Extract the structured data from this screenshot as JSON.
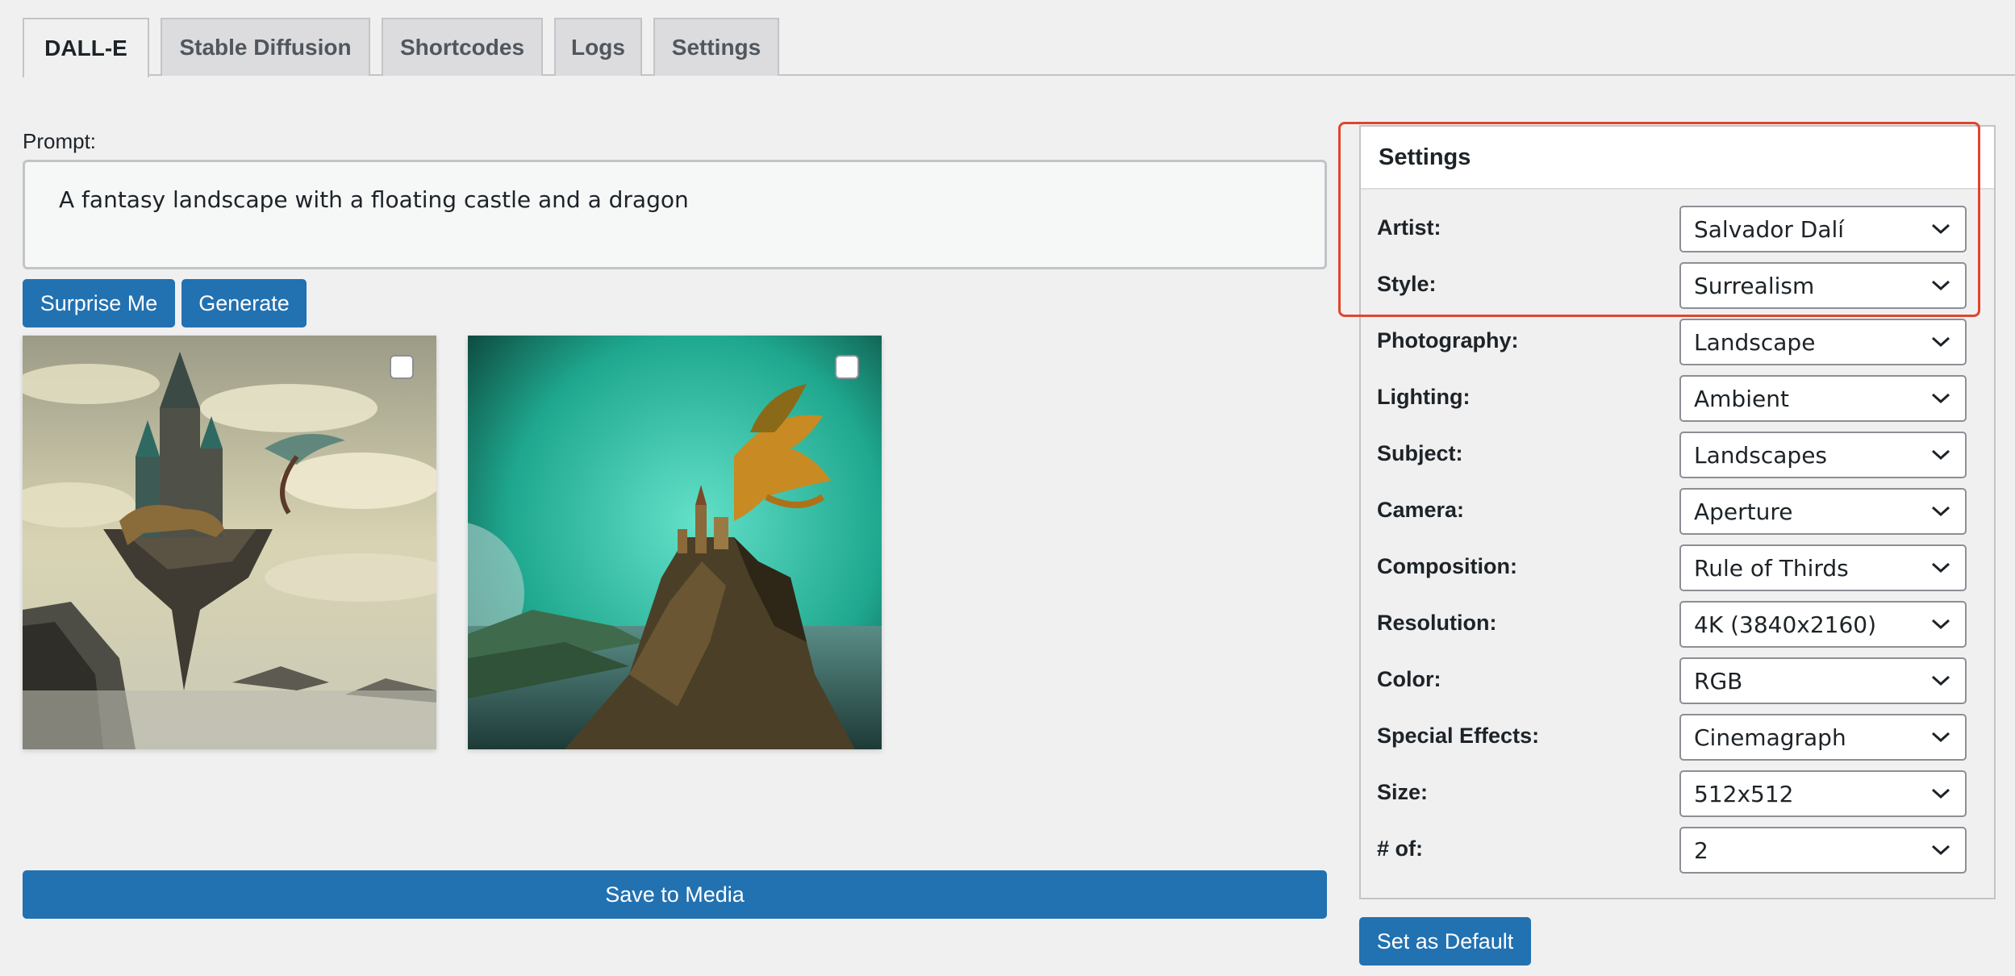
{
  "tabs": [
    {
      "label": "DALL-E",
      "active": true
    },
    {
      "label": "Stable Diffusion",
      "active": false
    },
    {
      "label": "Shortcodes",
      "active": false
    },
    {
      "label": "Logs",
      "active": false
    },
    {
      "label": "Settings",
      "active": false
    }
  ],
  "prompt": {
    "label": "Prompt:",
    "value": "A fantasy landscape with a floating castle and a dragon"
  },
  "buttons": {
    "surprise": "Surprise Me",
    "generate": "Generate",
    "save": "Save to Media",
    "set_default": "Set as Default"
  },
  "images": [
    {
      "name": "floating-castle-dragon-image-1",
      "selected": false
    },
    {
      "name": "castle-dragon-cliff-image-2",
      "selected": false
    }
  ],
  "settings": {
    "title": "Settings",
    "rows": [
      {
        "label": "Artist:",
        "value": "Salvador Dalí"
      },
      {
        "label": "Style:",
        "value": "Surrealism"
      },
      {
        "label": "Photography:",
        "value": "Landscape"
      },
      {
        "label": "Lighting:",
        "value": "Ambient"
      },
      {
        "label": "Subject:",
        "value": "Landscapes"
      },
      {
        "label": "Camera:",
        "value": "Aperture"
      },
      {
        "label": "Composition:",
        "value": "Rule of Thirds"
      },
      {
        "label": "Resolution:",
        "value": "4K (3840x2160)"
      },
      {
        "label": "Color:",
        "value": "RGB"
      },
      {
        "label": "Special Effects:",
        "value": "Cinemagraph"
      },
      {
        "label": "Size:",
        "value": "512x512"
      },
      {
        "label": "# of:",
        "value": "2"
      }
    ]
  },
  "colors": {
    "primary": "#2271b1",
    "highlight": "#e0452e",
    "background": "#f0f0f1"
  }
}
